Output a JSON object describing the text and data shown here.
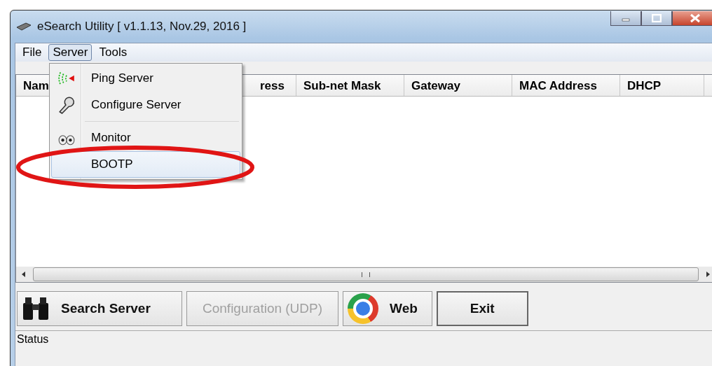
{
  "window": {
    "title": "eSearch Utility [ v1.1.13, Nov.29, 2016 ]"
  },
  "menu_bar": [
    {
      "label": "File",
      "selected": false
    },
    {
      "label": "Server",
      "selected": true
    },
    {
      "label": "Tools",
      "selected": false
    }
  ],
  "server_menu": [
    {
      "kind": "item",
      "label": "Ping Server",
      "selected": false
    },
    {
      "kind": "item",
      "label": "Configure Server",
      "selected": false
    },
    {
      "kind": "separator"
    },
    {
      "kind": "item",
      "label": "Monitor",
      "selected": false
    },
    {
      "kind": "item",
      "label": "BOOTP",
      "selected": true
    }
  ],
  "table": {
    "columns": [
      "Nam",
      "ress",
      "Sub-net Mask",
      "Gateway",
      "MAC Address",
      "DHCP"
    ]
  },
  "buttons": [
    {
      "label": "Search Server",
      "disabled": false
    },
    {
      "label": "Configuration (UDP)",
      "disabled": true
    },
    {
      "label": "Web",
      "disabled": false
    },
    {
      "label": "Exit",
      "disabled": false
    }
  ],
  "status_bar": "Status"
}
